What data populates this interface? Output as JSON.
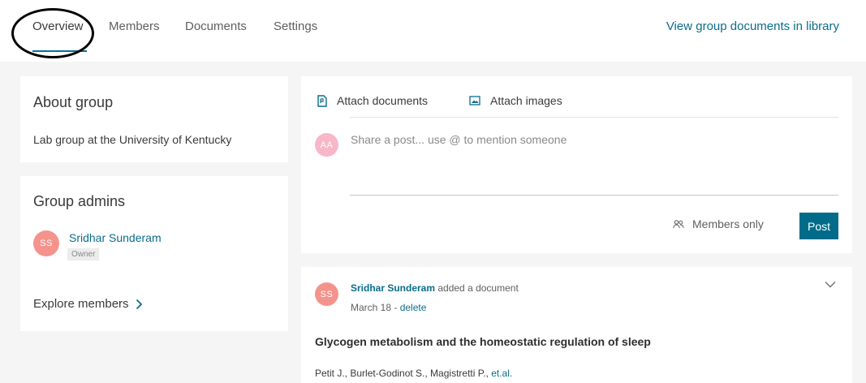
{
  "nav": {
    "tabs": [
      {
        "label": "Overview",
        "active": true
      },
      {
        "label": "Members",
        "active": false
      },
      {
        "label": "Documents",
        "active": false
      },
      {
        "label": "Settings",
        "active": false
      }
    ],
    "library_link": "View group documents in library"
  },
  "about": {
    "title": "About group",
    "description": "Lab group at the University of Kentucky"
  },
  "admins": {
    "title": "Group admins",
    "list": [
      {
        "initials": "SS",
        "name": "Sridhar Sunderam",
        "role": "Owner"
      }
    ],
    "explore_label": "Explore members"
  },
  "composer": {
    "attach_documents": "Attach documents",
    "attach_images": "Attach images",
    "user_initials": "AA",
    "placeholder": "Share a post... use @ to mention someone",
    "visibility": "Members only",
    "post_label": "Post"
  },
  "feed": {
    "items": [
      {
        "initials": "SS",
        "author": "Sridhar Sunderam",
        "action": " added a document",
        "date": "March 18 - ",
        "delete_label": "delete",
        "doc_title": "Glycogen metabolism and the homeostatic regulation of sleep",
        "authors": "Petit J., Burlet-Godinot S., Magistretti P., ",
        "etal": "et.al."
      }
    ]
  },
  "colors": {
    "accent": "#007398",
    "link": "#0a6d8a",
    "post_button": "#006c8a",
    "avatar_admin": "#f4938c",
    "avatar_user": "#f7b7c8",
    "background": "#f5f5f5",
    "annotation": "#000000"
  },
  "icons": {
    "attach_documents": "document-attach-icon",
    "attach_images": "image-icon",
    "members_only": "people-icon",
    "explore": "chevron-right-icon",
    "feed_menu": "chevron-down-icon"
  }
}
